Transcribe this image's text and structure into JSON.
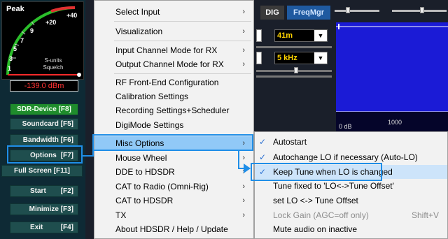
{
  "smeter": {
    "peak_label": "Peak",
    "scale": [
      "+40",
      "+20",
      "9",
      "7",
      "5",
      "3",
      "1"
    ],
    "units_line1": "S-units",
    "units_line2": "Squelch",
    "level_text": "-139.0 dBm"
  },
  "left_buttons": [
    {
      "label": "SDR-Device [F8]"
    },
    {
      "label": "Soundcard [F5]"
    },
    {
      "label": "Bandwidth [F6]"
    },
    {
      "label": "Options",
      "key": "[F7]"
    },
    {
      "label": "Full Screen [F11]"
    },
    {
      "label": "Start",
      "key": "[F2]"
    },
    {
      "label": "Minimize [F3]"
    },
    {
      "label": "Exit",
      "key": "[F4]"
    }
  ],
  "toolbar": {
    "dig_label": "DIG",
    "freqmgr_label": "FreqMgr",
    "band_select": "41m",
    "step_select": "5 kHz"
  },
  "spectrum": {
    "axis_db": "0 dB",
    "axis_freq": "1000"
  },
  "menu": {
    "items": [
      {
        "label": "Select Input",
        "submenu": true
      },
      {
        "label": "Visualization",
        "submenu": true
      },
      {
        "label": "Input Channel Mode for RX",
        "submenu": true
      },
      {
        "label": "Output Channel Mode for RX",
        "submenu": true
      },
      {
        "label": "RF Front-End Configuration",
        "submenu": false
      },
      {
        "label": "Calibration Settings",
        "submenu": false
      },
      {
        "label": "Recording Settings+Scheduler",
        "submenu": false
      },
      {
        "label": "DigiMode Settings",
        "submenu": false
      },
      {
        "label": "Misc Options",
        "submenu": true
      },
      {
        "label": "Mouse Wheel",
        "submenu": true
      },
      {
        "label": "DDE to HDSDR",
        "submenu": true
      },
      {
        "label": "CAT to Radio (Omni-Rig)",
        "submenu": true
      },
      {
        "label": "CAT to HDSDR",
        "submenu": true
      },
      {
        "label": "TX",
        "submenu": true
      },
      {
        "label": "About HDSDR / Help / Update",
        "submenu": false
      }
    ],
    "arrow": "›"
  },
  "submenu": {
    "items": [
      {
        "label": "Autostart",
        "checked": true
      },
      {
        "label": "Autochange LO if necessary (Auto-LO)",
        "checked": true
      },
      {
        "label": "Keep Tune when LO is changed",
        "checked": true
      },
      {
        "label": "Tune fixed to 'LO<->Tune Offset'",
        "checked": false
      },
      {
        "label": "set LO <-> Tune Offset",
        "checked": false
      },
      {
        "label": "Lock Gain (AGC=off only)",
        "checked": false,
        "disabled": true,
        "shortcut": "Shift+V"
      },
      {
        "label": "Mute audio on inactive",
        "checked": false
      }
    ],
    "check_glyph": "✓"
  },
  "colors": {
    "accent_callout": "#1f8ee8",
    "menu_highlight": "#91c9f7",
    "green_button": "#1f8c2c",
    "panel_button": "#1f4e4e",
    "dbm_text": "#ff3333"
  }
}
